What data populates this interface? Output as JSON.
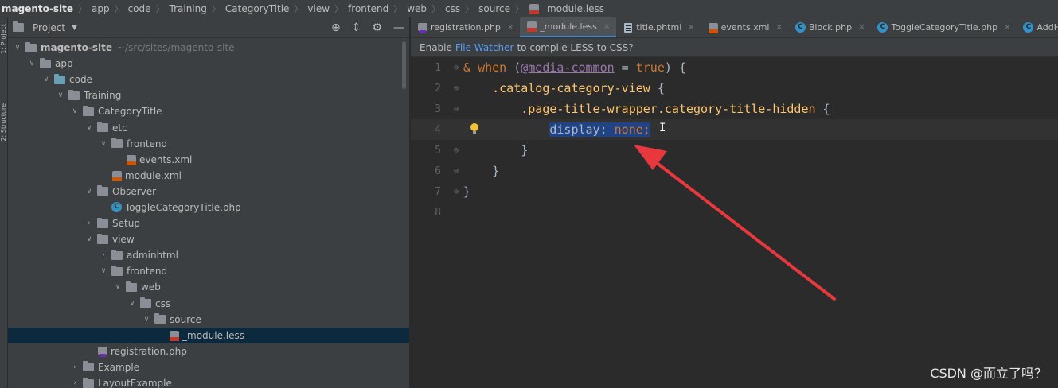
{
  "breadcrumb": {
    "items": [
      "magento-site",
      "app",
      "code",
      "Training",
      "CategoryTitle",
      "view",
      "frontend",
      "web",
      "css",
      "source"
    ],
    "current_file": "_module.less"
  },
  "left_strip": {
    "project_label": "1: Project",
    "structure_label": "2: Structure"
  },
  "project_panel": {
    "title": "Project",
    "tree": [
      {
        "label": "magento-site",
        "hint": "~/src/sites/magento-site",
        "depth": 0,
        "type": "folder",
        "expanded": true
      },
      {
        "label": "app",
        "depth": 1,
        "type": "folder",
        "expanded": true
      },
      {
        "label": "code",
        "depth": 2,
        "type": "folder-blue",
        "expanded": true
      },
      {
        "label": "Training",
        "depth": 3,
        "type": "folder",
        "expanded": true
      },
      {
        "label": "CategoryTitle",
        "depth": 4,
        "type": "folder",
        "expanded": true
      },
      {
        "label": "etc",
        "depth": 5,
        "type": "folder",
        "expanded": true
      },
      {
        "label": "frontend",
        "depth": 6,
        "type": "folder",
        "expanded": true
      },
      {
        "label": "events.xml",
        "depth": 7,
        "type": "xml"
      },
      {
        "label": "module.xml",
        "depth": 6,
        "type": "xml"
      },
      {
        "label": "Observer",
        "depth": 5,
        "type": "folder",
        "expanded": true
      },
      {
        "label": "ToggleCategoryTitle.php",
        "depth": 6,
        "type": "class"
      },
      {
        "label": "Setup",
        "depth": 5,
        "type": "folder",
        "expanded": false
      },
      {
        "label": "view",
        "depth": 5,
        "type": "folder",
        "expanded": true
      },
      {
        "label": "adminhtml",
        "depth": 6,
        "type": "folder",
        "expanded": false
      },
      {
        "label": "frontend",
        "depth": 6,
        "type": "folder",
        "expanded": true
      },
      {
        "label": "web",
        "depth": 7,
        "type": "folder",
        "expanded": true
      },
      {
        "label": "css",
        "depth": 8,
        "type": "folder",
        "expanded": true
      },
      {
        "label": "source",
        "depth": 9,
        "type": "folder",
        "expanded": true
      },
      {
        "label": "_module.less",
        "depth": 10,
        "type": "less",
        "selected": true
      },
      {
        "label": "registration.php",
        "depth": 5,
        "type": "php"
      },
      {
        "label": "Example",
        "depth": 4,
        "type": "folder",
        "expanded": false
      },
      {
        "label": "LayoutExample",
        "depth": 4,
        "type": "folder",
        "expanded": false
      }
    ]
  },
  "tabs": [
    {
      "label": "registration.php",
      "icon": "php",
      "active": false
    },
    {
      "label": "_module.less",
      "icon": "less",
      "active": true
    },
    {
      "label": "title.phtml",
      "icon": "phtml",
      "active": false
    },
    {
      "label": "events.xml",
      "icon": "xml",
      "active": false
    },
    {
      "label": "Block.php",
      "icon": "class",
      "active": false
    },
    {
      "label": "ToggleCategoryTitle.php",
      "icon": "class",
      "active": false
    },
    {
      "label": "AddHideTitle",
      "icon": "class",
      "active": false
    }
  ],
  "notice": {
    "prefix": "Enable",
    "link": "File Watcher",
    "suffix": "to compile LESS to CSS?"
  },
  "code": {
    "line_numbers": [
      "1",
      "2",
      "3",
      "4",
      "5",
      "6",
      "7",
      "8"
    ],
    "l1_amp": "& ",
    "l1_when": "when",
    "l1_open": " (",
    "l1_var": "@media-common",
    "l1_eq": " = ",
    "l1_true": "true",
    "l1_close": ") {",
    "l2_selector": ".catalog-category-view",
    "l2_brace": " {",
    "l3_selector": ".page-title-wrapper.category-title-hidden",
    "l3_brace": " {",
    "l4_prop": "display",
    "l4_colon": ": ",
    "l4_val": "none",
    "l4_semi": ";",
    "l5": "}",
    "l6": "}",
    "l7": "}"
  },
  "watermark": "CSDN @而立了吗？",
  "colors": {
    "accent": "#4a88c7",
    "arrow": "#e8383d",
    "selection": "#214283"
  }
}
